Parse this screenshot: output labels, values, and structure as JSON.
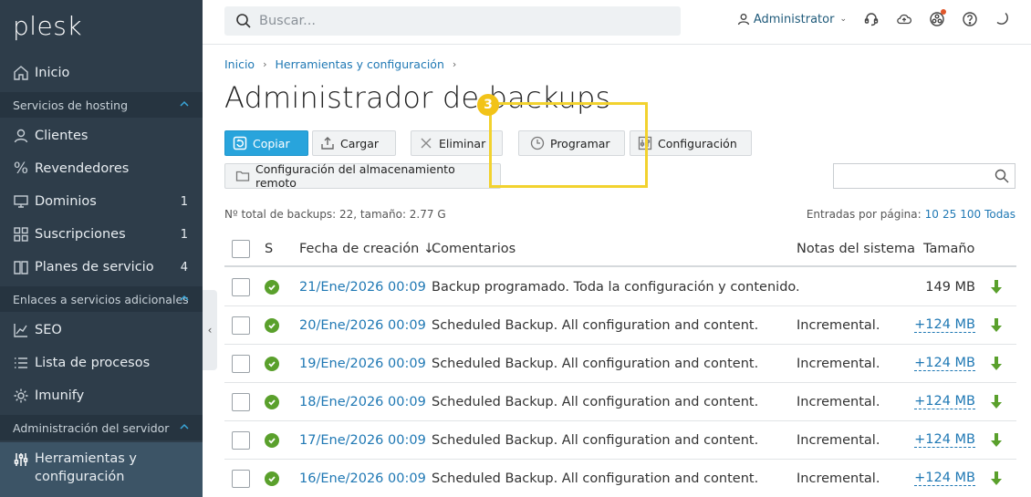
{
  "brand": {
    "logo_text": "plesk"
  },
  "sidebar": {
    "home": "Inicio",
    "sections": [
      {
        "label": "Servicios de hosting"
      },
      {
        "label": "Enlaces a servicios adicionales"
      },
      {
        "label": "Administración del servidor"
      }
    ],
    "hosting_items": [
      {
        "label": "Clientes",
        "count": ""
      },
      {
        "label": "Revendedores",
        "count": ""
      },
      {
        "label": "Dominios",
        "count": "1"
      },
      {
        "label": "Suscripciones",
        "count": "1"
      },
      {
        "label": "Planes de servicio",
        "count": "4"
      }
    ],
    "extra_items": [
      {
        "label": "SEO"
      },
      {
        "label": "Lista de procesos"
      },
      {
        "label": "Imunify"
      }
    ],
    "server_items": [
      {
        "label": "Herramientas y configuración"
      }
    ]
  },
  "header": {
    "search_placeholder": "Buscar...",
    "user": "Administrator"
  },
  "breadcrumb": [
    "Inicio",
    "Herramientas y configuración"
  ],
  "page_title": "Administrador de backups",
  "toolbar": {
    "copy": "Copiar",
    "upload": "Cargar",
    "delete": "Eliminar",
    "schedule": "Programar",
    "settings": "Configuración",
    "remote_storage": "Configuración del almacenamiento remoto"
  },
  "step_badge": "3",
  "summary": "Nº total de backups: 22, tamaño: 2.77 G",
  "pagination": {
    "label": "Entradas por página:",
    "options": [
      "10",
      "25",
      "100",
      "Todas"
    ]
  },
  "table": {
    "headers": {
      "status": "S",
      "date": "Fecha de creación ↓",
      "comments": "Comentarios",
      "notes": "Notas del sistema",
      "size": "Tamaño"
    },
    "rows": [
      {
        "date": "21/Ene/2026 00:09",
        "comment": "Backup programado. Toda la configuración y contenido.",
        "notes": "",
        "size": "149 MB",
        "size_link": false
      },
      {
        "date": "20/Ene/2026 00:09",
        "comment": "Scheduled Backup. All configuration and content.",
        "notes": "Incremental.",
        "size": "+124 MB",
        "size_link": true
      },
      {
        "date": "19/Ene/2026 00:09",
        "comment": "Scheduled Backup. All configuration and content.",
        "notes": "Incremental.",
        "size": "+124 MB",
        "size_link": true
      },
      {
        "date": "18/Ene/2026 00:09",
        "comment": "Scheduled Backup. All configuration and content.",
        "notes": "Incremental.",
        "size": "+124 MB",
        "size_link": true
      },
      {
        "date": "17/Ene/2026 00:09",
        "comment": "Scheduled Backup. All configuration and content.",
        "notes": "Incremental.",
        "size": "+124 MB",
        "size_link": true
      },
      {
        "date": "16/Ene/2026 00:09",
        "comment": "Scheduled Backup. All configuration and content.",
        "notes": "Incremental.",
        "size": "+124 MB",
        "size_link": true
      }
    ]
  },
  "colors": {
    "sidebar": "#2e3d4a",
    "primary": "#28a4dc",
    "link": "#1f78b4",
    "success": "#5aa02c",
    "highlight": "#f2d22e"
  }
}
